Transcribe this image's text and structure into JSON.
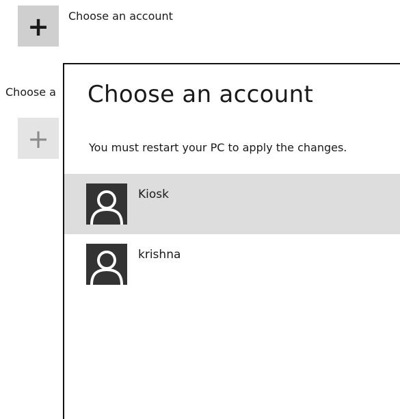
{
  "background": {
    "add_tile_icon": "plus-icon",
    "label_top": "Choose an account",
    "label_mid": "Choose a"
  },
  "flyout": {
    "title": "Choose an account",
    "message": "You must restart your PC to apply the changes.",
    "accounts": [
      {
        "name": "Kiosk",
        "selected": true,
        "avatar_icon": "user-silhouette-icon"
      },
      {
        "name": "krishna",
        "selected": false,
        "avatar_icon": "user-silhouette-icon"
      }
    ]
  },
  "colors": {
    "selected_row": "#dddddd",
    "avatar_bg": "#333333",
    "avatar_fg": "#ffffff",
    "tile_bg": "#cfcfcf"
  }
}
